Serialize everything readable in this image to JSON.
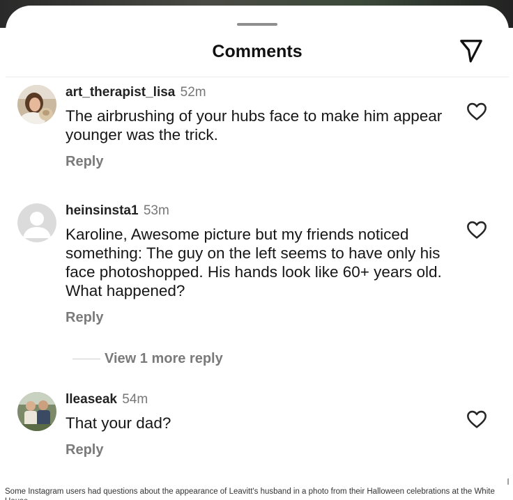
{
  "sheet": {
    "title": "Comments",
    "share_icon": "paper-plane-icon"
  },
  "comments": [
    {
      "username": "art_therapist_lisa",
      "time": "52m",
      "text": "The airbrushing of your hubs face to make him appear younger was the trick.",
      "reply_label": "Reply",
      "avatar": "photo-avatar-woman-with-dog",
      "like_icon": "heart-outline-icon"
    },
    {
      "username": "heinsinsta1",
      "time": "53m",
      "text": "Karoline, Awesome picture but my friends noticed something: The guy on the left seems to have only his face photoshopped. His hands look like 60+ years old. What happened?",
      "reply_label": "Reply",
      "avatar": "default-person-avatar",
      "like_icon": "heart-outline-icon",
      "view_more_label": "View 1 more reply"
    },
    {
      "username": "lleaseak",
      "time": "54m",
      "text": "That your dad?",
      "reply_label": "Reply",
      "avatar": "photo-avatar-two-people",
      "like_icon": "heart-outline-icon"
    }
  ],
  "caption": "Some Instagram users had questions about the appearance of Leavitt's husband in a photo from their Halloween celebrations at the White House."
}
